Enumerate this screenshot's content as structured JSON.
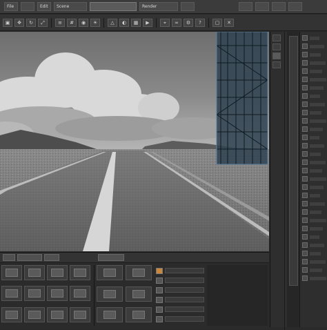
{
  "menubar": {
    "items": [
      "File",
      "",
      "Edit",
      "Scene",
      "",
      "Render",
      "",
      "",
      "",
      "",
      ""
    ],
    "title": "",
    "right_items": [
      "",
      "",
      "",
      ""
    ]
  },
  "toolbar": {
    "buttons": [
      "",
      "",
      "",
      "",
      "",
      "",
      "",
      "",
      "",
      "",
      "",
      "",
      "",
      "",
      "",
      "",
      "",
      "",
      "",
      ""
    ]
  },
  "viewport": {
    "scene": "road-desert-clouds"
  },
  "right_panel": {
    "rows": [
      "",
      "",
      "",
      "",
      "",
      "",
      "",
      "",
      "",
      "",
      "",
      "",
      "",
      "",
      "",
      "",
      "",
      "",
      "",
      "",
      "",
      "",
      "",
      "",
      "",
      "",
      "",
      "",
      "",
      ""
    ]
  },
  "timeline": {
    "tabs": [
      "",
      "",
      "",
      ""
    ],
    "playhead_label": ""
  },
  "colors": {
    "ui_bg": "#2a2a2a",
    "panel": "#333333",
    "accent_blue": "#3b5e7a",
    "orange_swatch": "#c8873a"
  }
}
